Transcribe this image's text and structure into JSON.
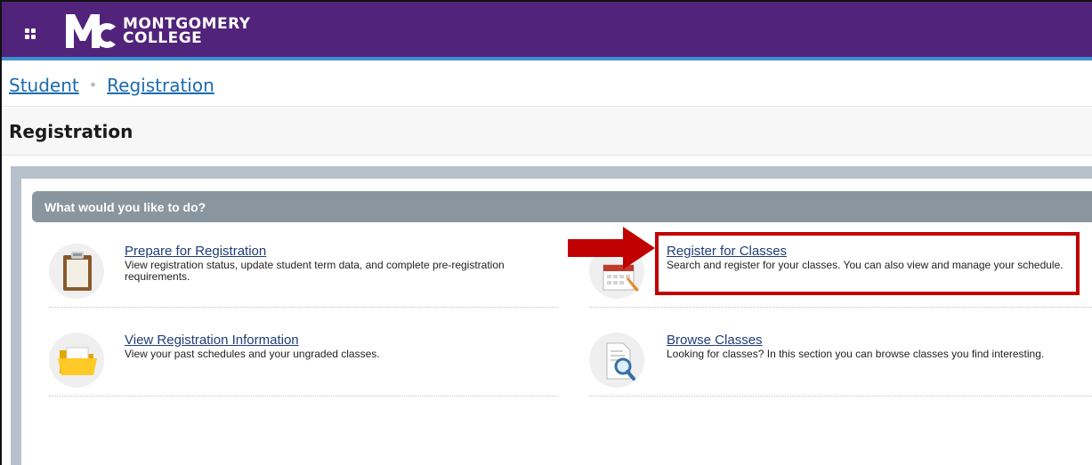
{
  "header": {
    "logo_line1": "MONTGOMERY",
    "logo_line2": "COLLEGE",
    "brand_color": "#51237a",
    "accent_color": "#3d8fd1"
  },
  "breadcrumb": {
    "items": [
      "Student",
      "Registration"
    ],
    "separator": "•"
  },
  "page": {
    "title": "Registration"
  },
  "panel": {
    "heading": "What would you like to do?",
    "tiles": [
      {
        "label": "Prepare for Registration",
        "description": "View registration status, update student term data, and complete pre-registration requirements.",
        "icon": "clipboard-icon"
      },
      {
        "label": "Register for Classes",
        "description": "Search and register for your classes. You can also view and manage your schedule.",
        "icon": "calendar-icon"
      },
      {
        "label": "View Registration Information",
        "description": "View your past schedules and your ungraded classes.",
        "icon": "folder-icon"
      },
      {
        "label": "Browse Classes",
        "description": "Looking for classes? In this section you can browse classes you find interesting.",
        "icon": "magnifier-document-icon"
      }
    ]
  },
  "annotation": {
    "highlight_color": "#c00000"
  }
}
